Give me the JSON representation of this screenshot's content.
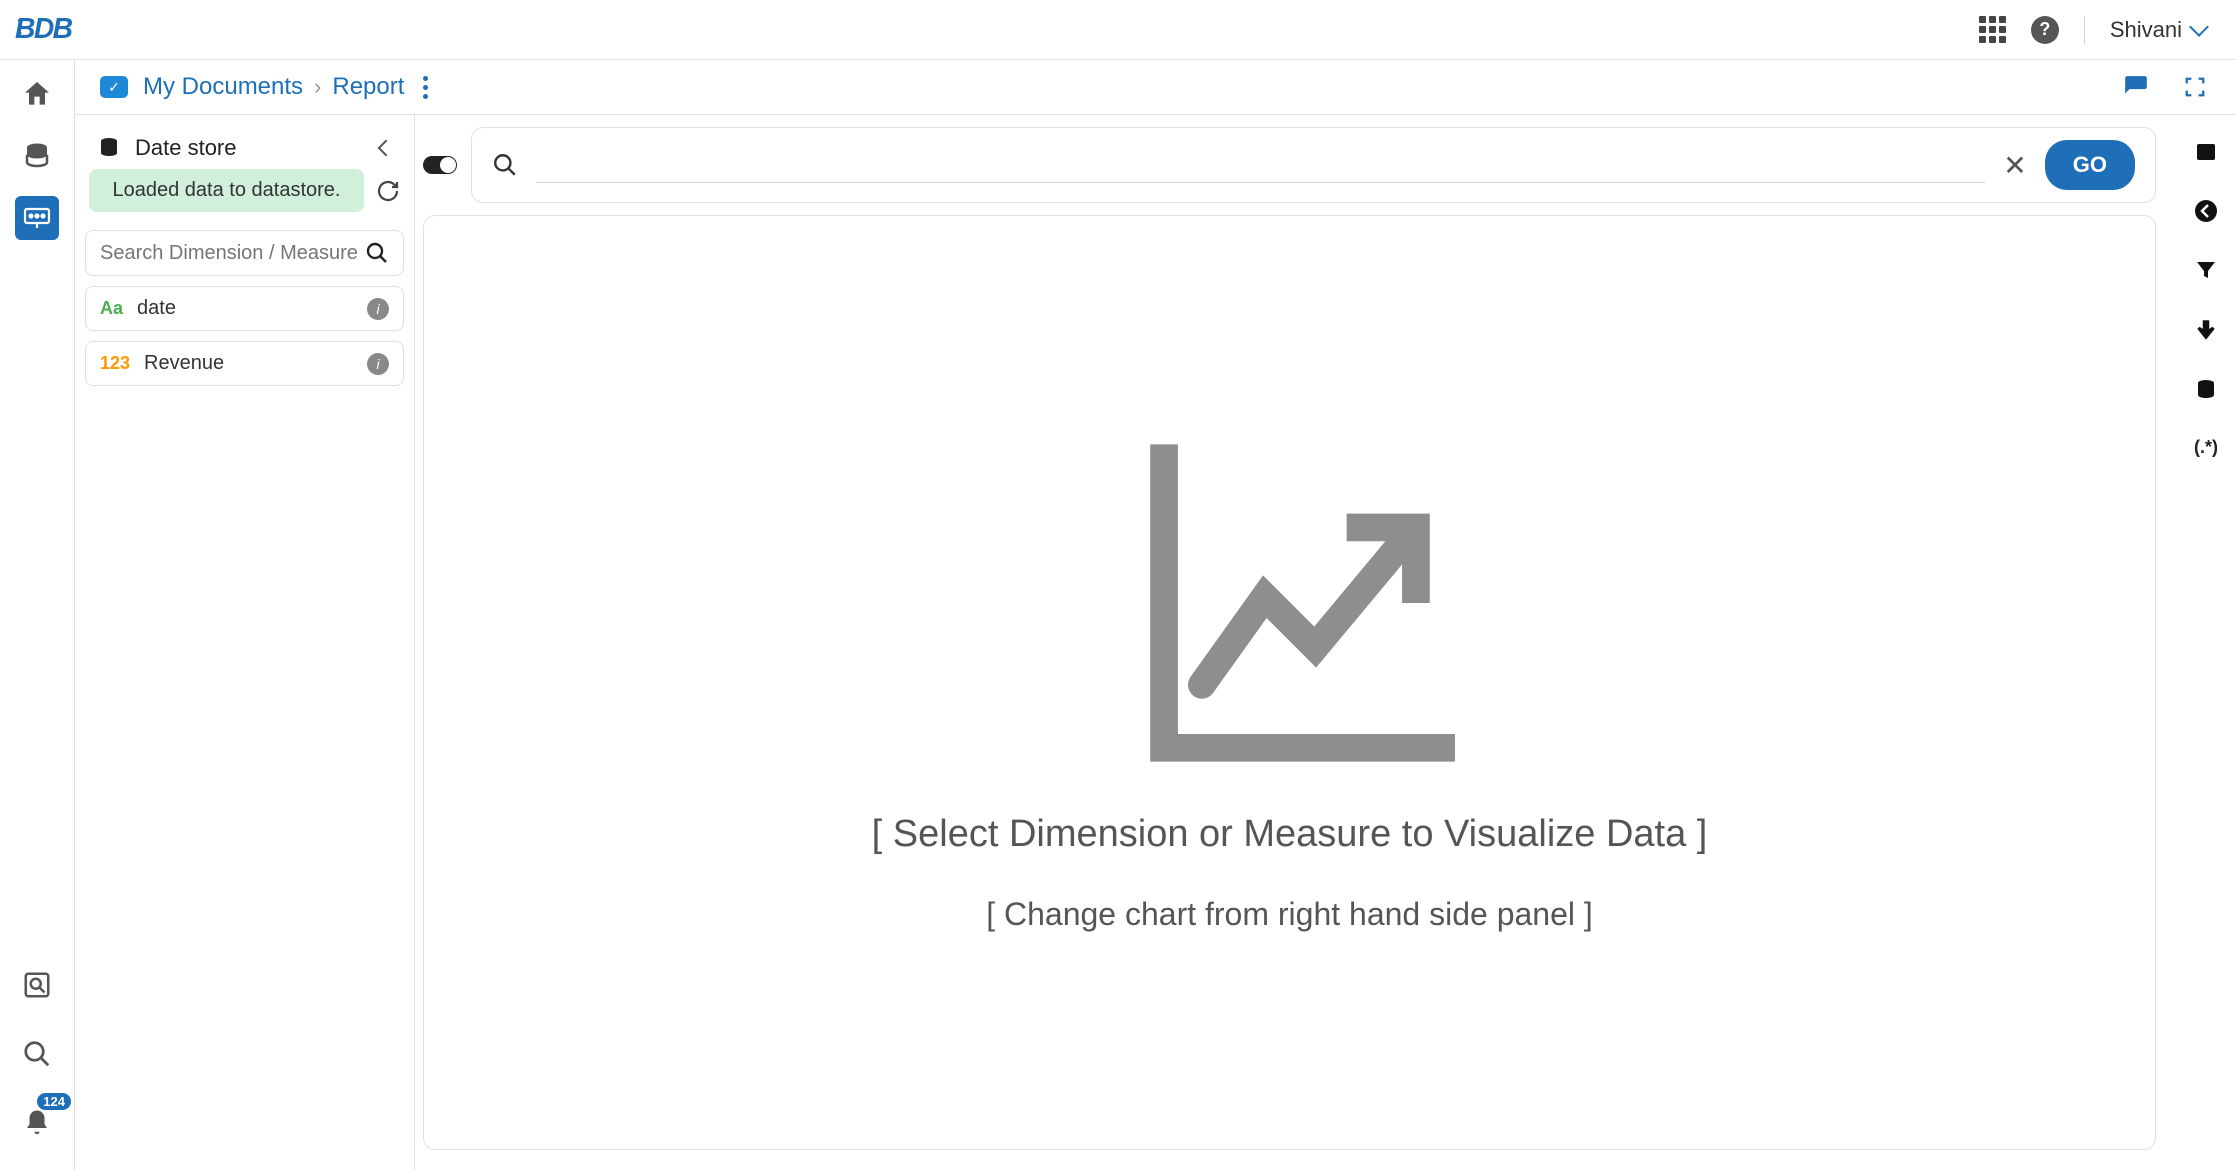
{
  "header": {
    "logo_text": "BDB",
    "user_name": "Shivani",
    "notification_count": "124"
  },
  "breadcrumb": {
    "items": [
      "My Documents",
      "Report"
    ]
  },
  "datastore": {
    "title": "Date store",
    "status_message": "Loaded data to datastore.",
    "search_placeholder": "Search Dimension / Measure",
    "fields": [
      {
        "type_label": "Aa",
        "name": "date",
        "kind": "dimension"
      },
      {
        "type_label": "123",
        "name": "Revenue",
        "kind": "measure"
      }
    ]
  },
  "query": {
    "go_label": "GO"
  },
  "canvas": {
    "message_primary": "[ Select Dimension or Measure to Visualize Data ]",
    "message_secondary": "[ Change chart from right hand side panel ]"
  }
}
